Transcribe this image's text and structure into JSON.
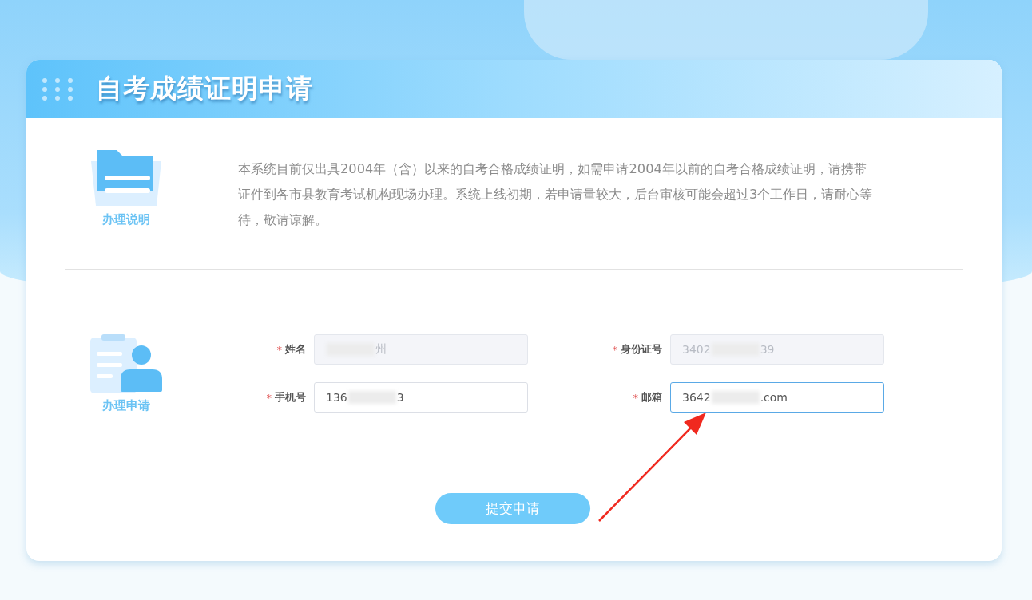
{
  "page_title": "自考成绩证明申请",
  "notice": {
    "label": "办理说明",
    "text": "本系统目前仅出具2004年（含）以来的自考合格成绩证明，如需申请2004年以前的自考合格成绩证明，请携带证件到各市县教育考试机构现场办理。系统上线初期，若申请量较大，后台审核可能会超过3个工作日，请耐心等待，敬请谅解。"
  },
  "form": {
    "label": "办理申请",
    "fields": [
      {
        "label": "姓名",
        "required_mark": "*",
        "disabled": true,
        "focused": false,
        "value_after": "州"
      },
      {
        "label": "身份证号",
        "required_mark": "*",
        "disabled": true,
        "focused": false,
        "value_before": "3402",
        "value_after": "39"
      },
      {
        "label": "手机号",
        "required_mark": "*",
        "disabled": false,
        "focused": false,
        "value_before": "136",
        "value_after": "3"
      },
      {
        "label": "邮箱",
        "required_mark": "*",
        "disabled": false,
        "focused": true,
        "annotated": true,
        "value_before": "3642",
        "value_after": ".com"
      }
    ],
    "submit": "提交申请"
  },
  "annotation": {
    "kind": "arrow"
  }
}
